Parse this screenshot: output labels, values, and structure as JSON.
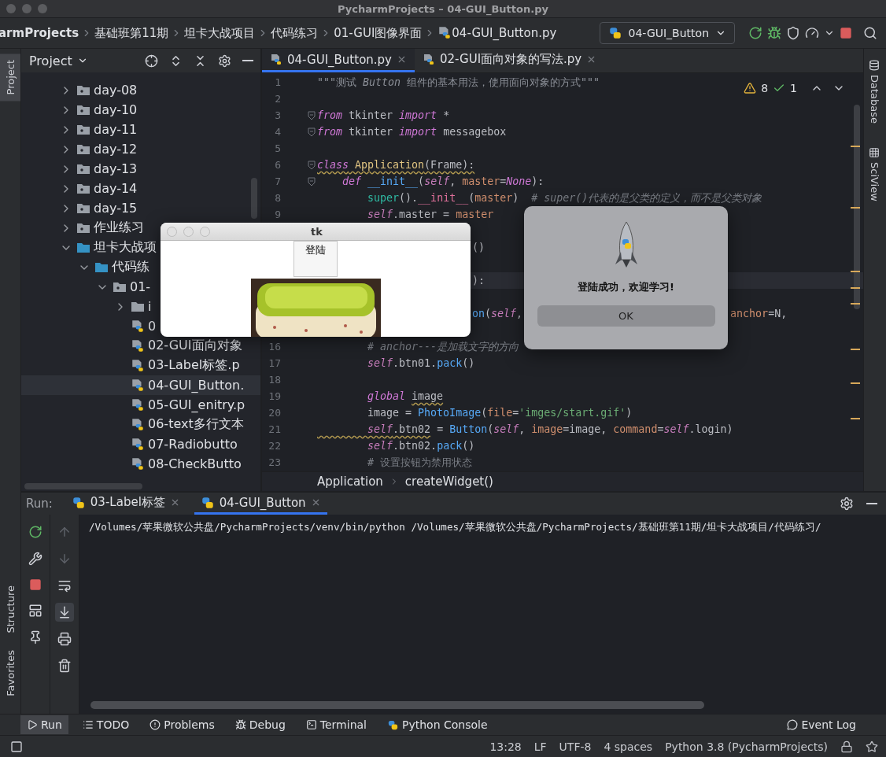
{
  "window": {
    "title": "PycharmProjects – 04-GUI_Button.py"
  },
  "breadcrumb": [
    "armProjects",
    "基础班第11期",
    "坦卡大战项目",
    "代码练习",
    "01-GUI图像界面",
    "04-GUI_Button.py"
  ],
  "run_config": "04-GUI_Button",
  "left_stripe": {
    "top": [
      {
        "label": "Project",
        "selected": true
      }
    ],
    "bottom": [
      {
        "label": "Structure",
        "selected": false
      },
      {
        "label": "Favorites",
        "selected": false
      }
    ]
  },
  "right_stripe": [
    {
      "label": "Database",
      "kind": "database"
    },
    {
      "label": "SciView",
      "kind": "sciview"
    }
  ],
  "project": {
    "title": "Project",
    "tree": [
      {
        "label": "day-08",
        "kind": "folder",
        "expanded": false,
        "selected": false
      },
      {
        "label": "day-10",
        "kind": "folder",
        "expanded": false,
        "selected": false
      },
      {
        "label": "day-11",
        "kind": "folder",
        "expanded": false,
        "selected": false
      },
      {
        "label": "day-12",
        "kind": "folder",
        "expanded": false,
        "selected": false
      },
      {
        "label": "day-13",
        "kind": "folder",
        "expanded": false,
        "selected": false
      },
      {
        "label": "day-14",
        "kind": "folder",
        "expanded": false,
        "selected": false
      },
      {
        "label": "day-15",
        "kind": "folder",
        "expanded": false,
        "selected": false
      },
      {
        "label": "作业练习",
        "kind": "folder",
        "expanded": false,
        "selected": false
      },
      {
        "label": "坦卡大战项",
        "kind": "root",
        "expanded": true,
        "selected": false,
        "children": [
          {
            "label": "代码练",
            "kind": "root",
            "expanded": true,
            "selected": false,
            "children": [
              {
                "label": "01-",
                "kind": "folder",
                "expanded": true,
                "selected": false,
                "children": [
                  {
                    "label": "i",
                    "kind": "plain",
                    "expanded": false,
                    "selected": false
                  },
                  {
                    "label": "0",
                    "kind": "file",
                    "selected": false
                  },
                  {
                    "label": "02-GUI面向对象",
                    "kind": "file",
                    "selected": false
                  },
                  {
                    "label": "03-Label标签.p",
                    "kind": "file",
                    "selected": false
                  },
                  {
                    "label": "04-GUI_Button.",
                    "kind": "file",
                    "selected": true
                  },
                  {
                    "label": "05-GUI_enitry.p",
                    "kind": "file",
                    "selected": false
                  },
                  {
                    "label": "06-text多行文本",
                    "kind": "file",
                    "selected": false
                  },
                  {
                    "label": "07-Radiobutto",
                    "kind": "file",
                    "selected": false
                  },
                  {
                    "label": "08-CheckButto",
                    "kind": "file",
                    "selected": false
                  }
                ]
              }
            ]
          }
        ]
      }
    ]
  },
  "editor": {
    "tabs": [
      {
        "label": "04-GUI_Button.py",
        "selected": true
      },
      {
        "label": "02-GUI面向对象的写法.py",
        "selected": false
      }
    ],
    "inspections": {
      "warnings": "8",
      "ok": "1"
    },
    "lines": [
      {
        "kind": "code",
        "number": "1",
        "current": false,
        "tokens": [
          {
            "kind": "doc",
            "text": "\"\"\"测试 "
          },
          {
            "kind": "doc-italic",
            "text": "Button"
          },
          {
            "kind": "doc",
            "text": " 组件的基本用法，使用面向对象的方式\"\"\""
          }
        ]
      },
      {
        "kind": "code",
        "number": "2",
        "current": false
      },
      {
        "kind": "code",
        "number": "3",
        "current": false,
        "fold": true,
        "tokens": [
          {
            "kind": "kw",
            "text": "from"
          },
          {
            "kind": "plain",
            "text": " tkinter "
          },
          {
            "kind": "kw",
            "text": "import"
          },
          {
            "kind": "plain",
            "text": " *"
          }
        ]
      },
      {
        "kind": "code",
        "number": "4",
        "current": false,
        "fold": true,
        "tokens": [
          {
            "kind": "kw",
            "text": "from"
          },
          {
            "kind": "plain",
            "text": " tkinter "
          },
          {
            "kind": "kw",
            "text": "import"
          },
          {
            "kind": "plain",
            "text": " messagebox"
          }
        ]
      },
      {
        "kind": "code",
        "number": "5",
        "current": false
      },
      {
        "kind": "code",
        "number": "6",
        "current": false,
        "fold": true,
        "tokens": [
          {
            "kind": "kw",
            "text": "class",
            "warning": true
          },
          {
            "kind": "cls",
            "text": " Application",
            "warning": true
          },
          {
            "kind": "plain",
            "text": "(Frame):",
            "warning": true
          }
        ]
      },
      {
        "kind": "code",
        "number": "7",
        "current": false,
        "fold": true,
        "tokens": [
          {
            "kind": "kw",
            "text": "    def"
          },
          {
            "kind": "fn",
            "text": " __init__"
          },
          {
            "kind": "plain",
            "text": "("
          },
          {
            "kind": "self",
            "text": "self"
          },
          {
            "kind": "plain",
            "text": ", "
          },
          {
            "kind": "param",
            "text": "master"
          },
          {
            "kind": "plain",
            "text": "="
          },
          {
            "kind": "kw",
            "text": "None"
          },
          {
            "kind": "plain",
            "text": "):"
          }
        ]
      },
      {
        "kind": "code",
        "number": "8",
        "current": false,
        "tokens": [
          {
            "kind": "builtin",
            "text": "        super"
          },
          {
            "kind": "plain",
            "text": "()."
          },
          {
            "kind": "magic",
            "text": "__init__"
          },
          {
            "kind": "plain",
            "text": "("
          },
          {
            "kind": "param",
            "text": "master"
          },
          {
            "kind": "plain",
            "text": ")  "
          },
          {
            "kind": "comment",
            "text": "# super()代表的是父类的定义，而不是父类对象"
          }
        ]
      },
      {
        "kind": "code",
        "number": "9",
        "current": false,
        "tokens": [
          {
            "kind": "self",
            "text": "        self"
          },
          {
            "kind": "plain",
            "text": ".master = "
          },
          {
            "kind": "param",
            "text": "master"
          }
        ]
      },
      {
        "kind": "hidden"
      },
      {
        "kind": "partial",
        "current": false,
        "fragments": [
          [
            {
              "kind": "plain",
              "text": "()"
            }
          ]
        ]
      },
      {
        "kind": "hidden"
      },
      {
        "kind": "partial",
        "current": true,
        "fragments": [
          [
            {
              "kind": "plain",
              "text": "):"
            }
          ]
        ]
      },
      {
        "kind": "hidden"
      },
      {
        "kind": "partial",
        "current": false,
        "fragments": [
          [
            {
              "kind": "fn",
              "text": "on"
            },
            {
              "kind": "plain",
              "text": "("
            },
            {
              "kind": "self",
              "text": "self"
            },
            {
              "kind": "plain",
              "text": ","
            }
          ],
          [
            {
              "kind": "param",
              "text": "anchor"
            },
            {
              "kind": "plain",
              "text": "=N,"
            }
          ]
        ]
      },
      {
        "kind": "hidden"
      },
      {
        "kind": "code",
        "number": "16",
        "current": false,
        "tokens": [
          {
            "kind": "comment",
            "text": "        # anchor---是加载文字的方向"
          }
        ]
      },
      {
        "kind": "code",
        "number": "17",
        "current": false,
        "tokens": [
          {
            "kind": "self",
            "text": "        self"
          },
          {
            "kind": "plain",
            "text": ".btn01."
          },
          {
            "kind": "fn",
            "text": "pack"
          },
          {
            "kind": "plain",
            "text": "()"
          }
        ]
      },
      {
        "kind": "code",
        "number": "18",
        "current": false
      },
      {
        "kind": "code",
        "number": "19",
        "current": false,
        "tokens": [
          {
            "kind": "kw",
            "text": "        global "
          },
          {
            "kind": "plain",
            "text": "image",
            "warning": true
          }
        ]
      },
      {
        "kind": "code",
        "number": "20",
        "current": false,
        "tokens": [
          {
            "kind": "plain",
            "text": "        image = "
          },
          {
            "kind": "fn",
            "text": "PhotoImage"
          },
          {
            "kind": "plain",
            "text": "("
          },
          {
            "kind": "param",
            "text": "file"
          },
          {
            "kind": "plain",
            "text": "="
          },
          {
            "kind": "str",
            "text": "'imges/start.gif'"
          },
          {
            "kind": "plain",
            "text": ")"
          }
        ]
      },
      {
        "kind": "code",
        "number": "21",
        "current": false,
        "tokens": [
          {
            "kind": "self",
            "text": "        self",
            "warning": true
          },
          {
            "kind": "plain",
            "text": ".btn02",
            "warning": true
          },
          {
            "kind": "plain",
            "text": " = "
          },
          {
            "kind": "fn",
            "text": "Button"
          },
          {
            "kind": "plain",
            "text": "("
          },
          {
            "kind": "self",
            "text": "self"
          },
          {
            "kind": "plain",
            "text": ", "
          },
          {
            "kind": "param",
            "text": "image"
          },
          {
            "kind": "plain",
            "text": "=image, "
          },
          {
            "kind": "param",
            "text": "command"
          },
          {
            "kind": "plain",
            "text": "="
          },
          {
            "kind": "self",
            "text": "self"
          },
          {
            "kind": "plain",
            "text": ".login)"
          }
        ]
      },
      {
        "kind": "code",
        "number": "22",
        "current": false,
        "tokens": [
          {
            "kind": "self",
            "text": "        self"
          },
          {
            "kind": "plain",
            "text": ".btn02."
          },
          {
            "kind": "fn",
            "text": "pack"
          },
          {
            "kind": "plain",
            "text": "()"
          }
        ]
      },
      {
        "kind": "code",
        "number": "23",
        "current": false,
        "tokens": [
          {
            "kind": "comment-plain",
            "text": "        # 设置按钮为禁用状态"
          }
        ]
      }
    ],
    "breadcrumb": [
      "Application",
      "createWidget()"
    ]
  },
  "run": {
    "title": "Run:",
    "tabs": [
      {
        "label": "03-Label标签",
        "selected": false
      },
      {
        "label": "04-GUI_Button",
        "selected": true
      }
    ],
    "output": "/Volumes/苹果微软公共盘/PycharmProjects/venv/bin/python /Volumes/苹果微软公共盘/PycharmProjects/基础班第11期/坦卡大战项目/代码练习/"
  },
  "tool_windows": [
    {
      "label": "Run",
      "kind": "run",
      "selected": true
    },
    {
      "label": "TODO",
      "kind": "todo",
      "selected": false
    },
    {
      "label": "Problems",
      "kind": "problems",
      "selected": false
    },
    {
      "label": "Debug",
      "kind": "debug",
      "selected": false
    },
    {
      "label": "Terminal",
      "kind": "terminal",
      "selected": false
    },
    {
      "label": "Python Console",
      "kind": "console",
      "selected": false
    }
  ],
  "event_log": "Event Log",
  "status_bar": [
    "13:28",
    "LF",
    "UTF-8",
    "4 spaces",
    "Python 3.8 (PycharmProjects)"
  ],
  "tk_window": {
    "title": "tk",
    "button": "登陆"
  },
  "dialog": {
    "message": "登陆成功，欢迎学习!",
    "button": "OK"
  }
}
